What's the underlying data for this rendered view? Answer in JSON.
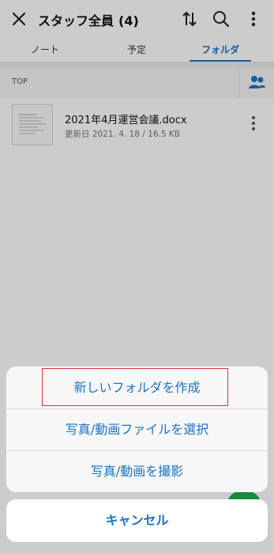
{
  "header": {
    "title": "スタッフ全員",
    "count": "(4)"
  },
  "tabs": [
    {
      "label": "ノート",
      "active": false
    },
    {
      "label": "予定",
      "active": false
    },
    {
      "label": "フォルダ",
      "active": true
    }
  ],
  "breadcrumb": {
    "label": "TOP"
  },
  "file": {
    "name": "2021年4月運営会議.docx",
    "meta": "更新日 2021. 4. 18 / 16.5 KB"
  },
  "action_sheet": {
    "items": [
      {
        "label": "新しいフォルダを作成",
        "highlighted": true
      },
      {
        "label": "写真/動画ファイルを選択",
        "highlighted": false
      },
      {
        "label": "写真/動画を撮影",
        "highlighted": false
      }
    ],
    "cancel_label": "キャンセル"
  },
  "colors": {
    "accent": "#1a73c9",
    "highlight_border": "#d5333a",
    "fab": "#18b04a"
  },
  "icons": {
    "close": "close-icon",
    "sort": "sort-icon",
    "search": "search-icon",
    "more": "more-vertical-icon",
    "share": "people-icon"
  }
}
